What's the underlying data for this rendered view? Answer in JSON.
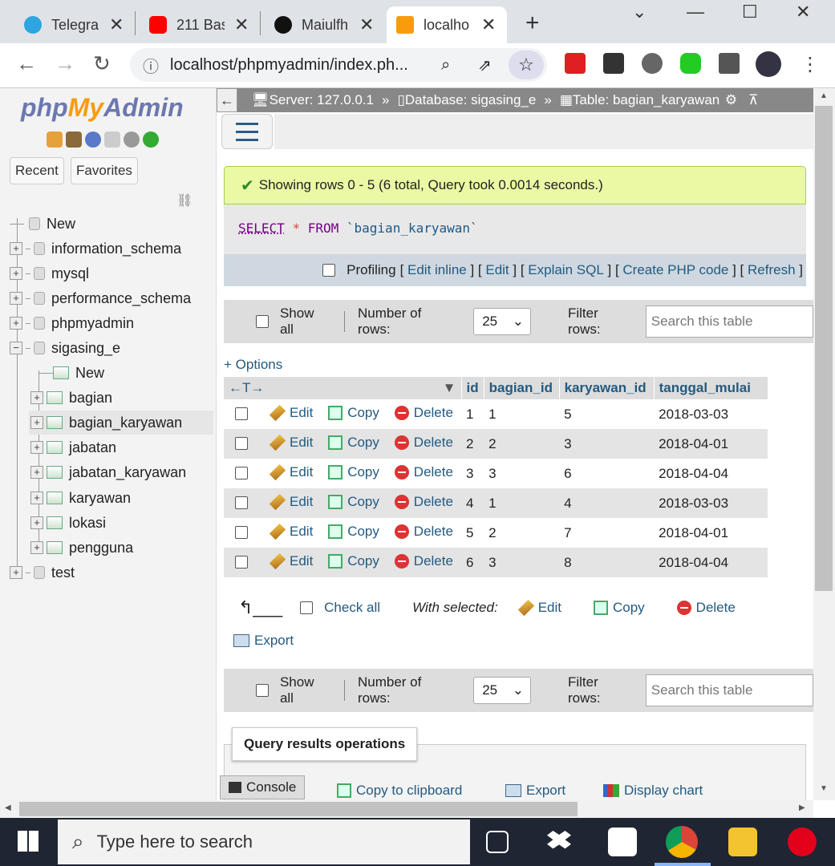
{
  "browser": {
    "tabs": [
      {
        "title": "Telegra",
        "favicon_color": "#2ca5e0"
      },
      {
        "title": "211 Bas",
        "favicon_color": "#ff0000"
      },
      {
        "title": "Maiulfh",
        "favicon_color": "#111111"
      },
      {
        "title": "localho",
        "favicon_color": "#f89c0e",
        "active": true
      }
    ],
    "url": "localhost/phpmyadmin/index.ph..."
  },
  "sidebar": {
    "logo_php": "php",
    "logo_my": "My",
    "logo_admin": "Admin",
    "tabs": [
      "Recent",
      "Favorites"
    ],
    "tree": [
      {
        "label": "New",
        "type": "new"
      },
      {
        "label": "information_schema",
        "type": "db"
      },
      {
        "label": "mysql",
        "type": "db"
      },
      {
        "label": "performance_schema",
        "type": "db"
      },
      {
        "label": "phpmyadmin",
        "type": "db"
      },
      {
        "label": "sigasing_e",
        "type": "db",
        "expanded": true
      },
      {
        "label": "New",
        "type": "new-table"
      },
      {
        "label": "bagian",
        "type": "table"
      },
      {
        "label": "bagian_karyawan",
        "type": "table",
        "selected": true
      },
      {
        "label": "jabatan",
        "type": "table"
      },
      {
        "label": "jabatan_karyawan",
        "type": "table"
      },
      {
        "label": "karyawan",
        "type": "table"
      },
      {
        "label": "lokasi",
        "type": "table"
      },
      {
        "label": "pengguna",
        "type": "table"
      },
      {
        "label": "test",
        "type": "db"
      }
    ]
  },
  "breadcrumb": {
    "server": "Server: 127.0.0.1",
    "database": "Database: sigasing_e",
    "table": "Table: bagian_karyawan",
    "sep": "»"
  },
  "result": {
    "message": "Showing rows 0 - 5 (6 total, Query took 0.0014 seconds.)",
    "sql_select": "SELECT",
    "sql_star": "*",
    "sql_from": "FROM",
    "sql_table": "`bagian_karyawan`",
    "profiling": "Profiling",
    "links": [
      "Edit inline",
      "Edit",
      "Explain SQL",
      "Create PHP code",
      "Refresh"
    ]
  },
  "navbar": {
    "show_all": "Show all",
    "rows_label": "Number of rows:",
    "rows_value": "25",
    "filter_label": "Filter rows:",
    "filter_placeholder": "Search this table"
  },
  "options_link": "+ Options",
  "table": {
    "columns": [
      "id",
      "bagian_id",
      "karyawan_id",
      "tanggal_mulai"
    ],
    "action_labels": {
      "edit": "Edit",
      "copy": "Copy",
      "delete": "Delete"
    },
    "rows": [
      [
        "1",
        "1",
        "5",
        "2018-03-03"
      ],
      [
        "2",
        "2",
        "3",
        "2018-04-01"
      ],
      [
        "3",
        "3",
        "6",
        "2018-04-04"
      ],
      [
        "4",
        "1",
        "4",
        "2018-03-03"
      ],
      [
        "5",
        "2",
        "7",
        "2018-04-01"
      ],
      [
        "6",
        "3",
        "8",
        "2018-04-04"
      ]
    ]
  },
  "bulk": {
    "check_all": "Check all",
    "with_selected": "With selected:",
    "edit": "Edit",
    "copy": "Copy",
    "delete": "Delete",
    "export": "Export"
  },
  "query_ops": {
    "title": "Query results operations",
    "console": "Console",
    "copy_clipboard": "Copy to clipboard",
    "export": "Export",
    "display_chart": "Display chart"
  },
  "taskbar": {
    "search_placeholder": "Type here to search"
  }
}
